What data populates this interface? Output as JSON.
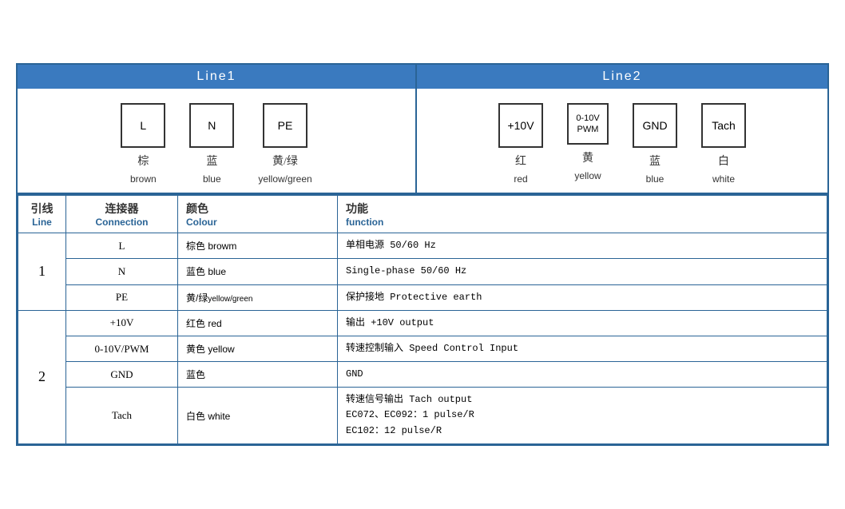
{
  "header": {
    "line1_label": "Line1",
    "line2_label": "Line2"
  },
  "line1_connectors": [
    {
      "box_label": "L",
      "cn": "棕",
      "en": "brown"
    },
    {
      "box_label": "N",
      "cn": "蓝",
      "en": "blue"
    },
    {
      "box_label": "PE",
      "cn": "黄/绿",
      "en": "yellow/green"
    }
  ],
  "line2_connectors": [
    {
      "box_label": "+10V",
      "cn": "红",
      "en": "red"
    },
    {
      "box_label": "0-10V\nPWM",
      "cn": "黄",
      "en": "yellow"
    },
    {
      "box_label": "GND",
      "cn": "蓝",
      "en": "blue"
    },
    {
      "box_label": "Tach",
      "cn": "白",
      "en": "white"
    }
  ],
  "table": {
    "headers": {
      "line_cn": "引线",
      "line_en": "Line",
      "conn_cn": "连接器",
      "conn_en": "Connection",
      "color_cn": "颜色",
      "color_en": "Colour",
      "func_cn": "功能",
      "func_en": "function"
    },
    "rows": [
      {
        "line": "1",
        "line_rowspan": 3,
        "entries": [
          {
            "conn": "L",
            "color_cn": "棕色",
            "color_en": "browm",
            "func": "单相电源 50/60 Hz"
          },
          {
            "conn": "N",
            "color_cn": "蓝色",
            "color_en": "blue",
            "func": "Single-phase 50/60 Hz"
          },
          {
            "conn": "PE",
            "color_cn": "黄/绿",
            "color_en_small": "yellow/green",
            "func": "保护接地 Protective earth"
          }
        ]
      },
      {
        "line": "2",
        "line_rowspan": 4,
        "entries": [
          {
            "conn": "+10V",
            "color_cn": "红色",
            "color_en": "red",
            "func": "输出 +10V output"
          },
          {
            "conn": "0-10V/PWM",
            "color_cn": "黄色",
            "color_en": "yellow",
            "func": "转速控制输入 Speed Control Input"
          },
          {
            "conn": "GND",
            "color_cn": "蓝色",
            "color_en": "",
            "func": "GND"
          },
          {
            "conn": "Tach",
            "color_cn": "白色",
            "color_en": "white",
            "func": "转速信号输出 Tach output\nEC072、EC092：1 pulse/R\nEC102：12 pulse/R"
          }
        ]
      }
    ]
  }
}
